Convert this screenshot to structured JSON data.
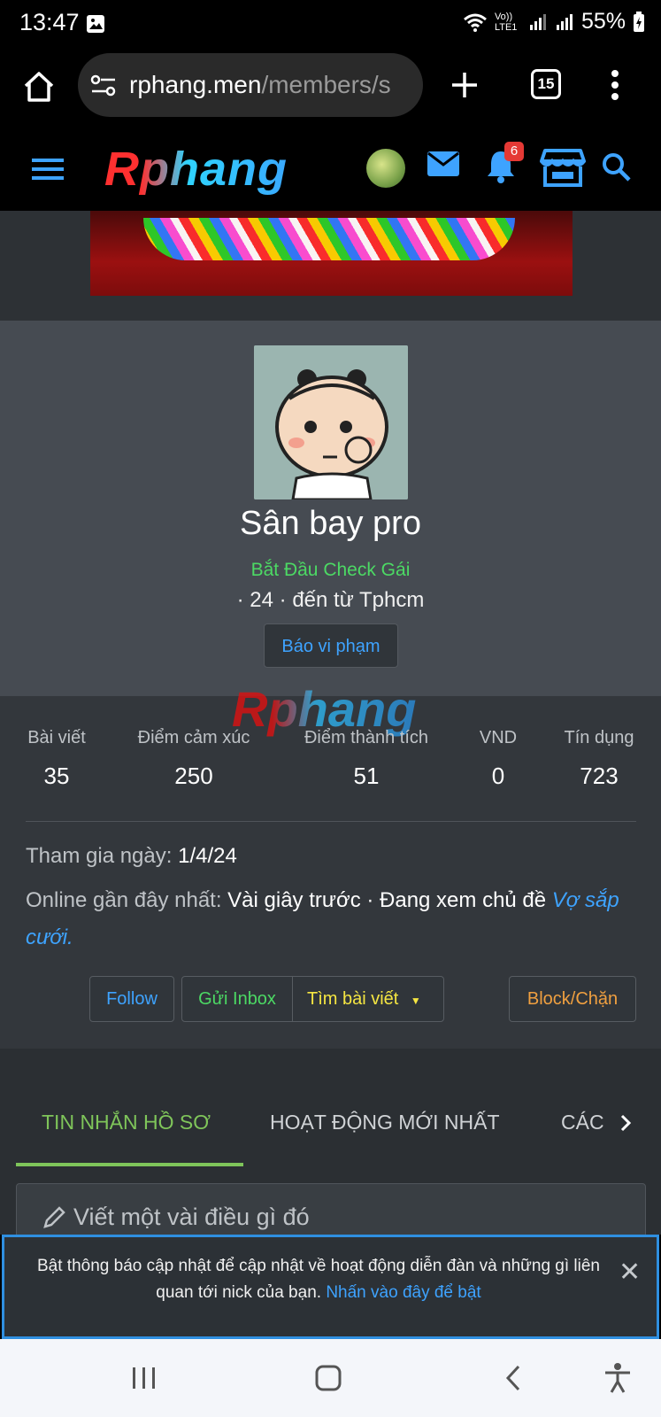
{
  "status_bar": {
    "time": "13:47",
    "network": "Vo)) LTE1",
    "battery": "55%"
  },
  "browser": {
    "url_host": "rphang.men",
    "url_path": "/members/s",
    "tab_count": "15"
  },
  "header": {
    "logo": "Rphang",
    "notification_count": "6"
  },
  "profile": {
    "name": "Sân bay pro",
    "title": "Bắt Đầu Check Gái",
    "meta": "· 24 · đến từ Tphcm",
    "report_label": "Báo vi phạm",
    "watermark": "Rphang"
  },
  "stats": [
    {
      "label": "Bài viết",
      "value": "35"
    },
    {
      "label": "Điểm cảm xúc",
      "value": "250"
    },
    {
      "label": "Điểm thành tích",
      "value": "51"
    },
    {
      "label": "VND",
      "value": "0"
    },
    {
      "label": "Tín dụng",
      "value": "723"
    }
  ],
  "info": {
    "joined_label": "Tham gia ngày:",
    "joined_value": "1/4/24",
    "online_label": "Online gần đây nhất:",
    "online_value": "Vài giây trước · Đang xem chủ đề",
    "online_link": "Vợ sắp cưới."
  },
  "actions": {
    "follow": "Follow",
    "inbox": "Gửi Inbox",
    "find_posts": "Tìm bài viết",
    "block": "Block/Chặn"
  },
  "tabs": [
    "TIN NHẮN HỒ SƠ",
    "HOẠT ĐỘNG MỚI NHẤT",
    "CÁC B"
  ],
  "compose_placeholder": "Viết một vài điều gì đó",
  "notification": {
    "text": "Bật thông báo cập nhật để cập nhật về hoạt động diễn đàn và những gì liên quan tới nick của bạn.",
    "link": "Nhấn vào đây để bật"
  },
  "colors": {
    "accent_blue": "#3ea3ff",
    "title_green": "#4cd964",
    "follow_blue": "#3ea3ff",
    "inbox_green": "#4cd964",
    "find_yellow": "#f5e642",
    "block_orange": "#f0a040",
    "tab_active": "#7fc55a"
  }
}
